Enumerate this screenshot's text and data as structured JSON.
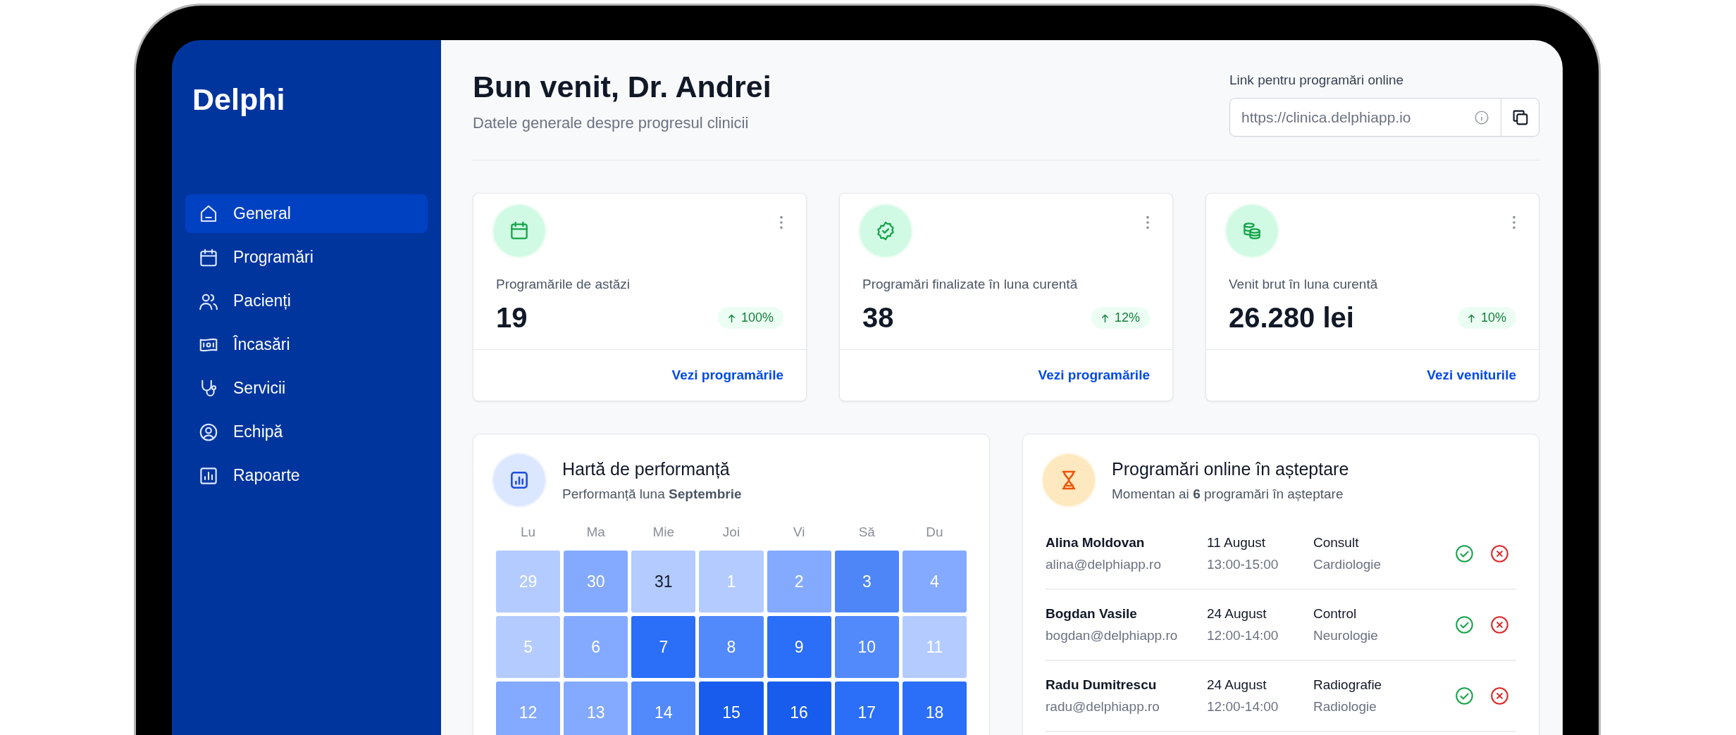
{
  "sidebar": {
    "logo": "Delphi",
    "items": [
      {
        "label": "General",
        "selected": true
      },
      {
        "label": "Programări",
        "selected": false
      },
      {
        "label": "Pacienți",
        "selected": false
      },
      {
        "label": "Încasări",
        "selected": false
      },
      {
        "label": "Servicii",
        "selected": false
      },
      {
        "label": "Echipă",
        "selected": false
      },
      {
        "label": "Rapoarte",
        "selected": false
      }
    ]
  },
  "header": {
    "title": "Bun venit, Dr. Andrei",
    "subtitle": "Datele generale despre progresul clinicii",
    "link_label": "Link pentru programări online",
    "link_value": "https://clinica.delphiapp.io"
  },
  "stats": [
    {
      "label": "Programările de astăzi",
      "value": "19",
      "change": "100%",
      "link": "Vezi programările"
    },
    {
      "label": "Programări finalizate în luna curentă",
      "value": "38",
      "change": "12%",
      "link": "Vezi programările"
    },
    {
      "label": "Venit brut în luna curentă",
      "value": "26.280 lei",
      "change": "10%",
      "link": "Vezi veniturile"
    }
  ],
  "heatmap": {
    "title": "Hartă de performanță",
    "subtitle": "Performanță luna **Septembrie**",
    "weekdays": [
      "Lu",
      "Ma",
      "Mie",
      "Joi",
      "Vi",
      "Să",
      "Du"
    ],
    "cells": [
      {
        "day": "29",
        "color": "#b3cbff",
        "today": false
      },
      {
        "day": "30",
        "color": "#84aaff",
        "today": false
      },
      {
        "day": "31",
        "color": "#b3cbff",
        "today": true
      },
      {
        "day": "1",
        "color": "#b3cbff",
        "today": false
      },
      {
        "day": "2",
        "color": "#84aaff",
        "today": false
      },
      {
        "day": "3",
        "color": "#4f86f7",
        "today": false
      },
      {
        "day": "4",
        "color": "#84aaff",
        "today": false
      },
      {
        "day": "5",
        "color": "#b3cbff",
        "today": false
      },
      {
        "day": "6",
        "color": "#84aaff",
        "today": false
      },
      {
        "day": "7",
        "color": "#2b6ef8",
        "today": false
      },
      {
        "day": "8",
        "color": "#5289fb",
        "today": false
      },
      {
        "day": "9",
        "color": "#2b6ef8",
        "today": false
      },
      {
        "day": "10",
        "color": "#5289fb",
        "today": false
      },
      {
        "day": "11",
        "color": "#b3cbff",
        "today": false
      },
      {
        "day": "12",
        "color": "#84aaff",
        "today": false
      },
      {
        "day": "13",
        "color": "#84aaff",
        "today": false
      },
      {
        "day": "14",
        "color": "#5289fb",
        "today": false
      },
      {
        "day": "15",
        "color": "#185ced",
        "today": false
      },
      {
        "day": "16",
        "color": "#185ced",
        "today": false
      },
      {
        "day": "17",
        "color": "#2b6ef8",
        "today": false
      },
      {
        "day": "18",
        "color": "#2b6ef8",
        "today": false
      }
    ]
  },
  "pending": {
    "title": "Programări online în așteptare",
    "subtitle": "Momentan ai **6** programări în așteptare",
    "rows": [
      {
        "name": "Alina Moldovan",
        "email": "alina@delphiapp.ro",
        "date": "11 August",
        "time": "13:00-15:00",
        "type": "Consult",
        "specialty": "Cardiologie"
      },
      {
        "name": "Bogdan Vasile",
        "email": "bogdan@delphiapp.ro",
        "date": "24 August",
        "time": "12:00-14:00",
        "type": "Control",
        "specialty": "Neurologie"
      },
      {
        "name": "Radu Dumitrescu",
        "email": "radu@delphiapp.ro",
        "date": "24 August",
        "time": "12:00-14:00",
        "type": "Radiografie",
        "specialty": "Radiologie"
      }
    ]
  }
}
